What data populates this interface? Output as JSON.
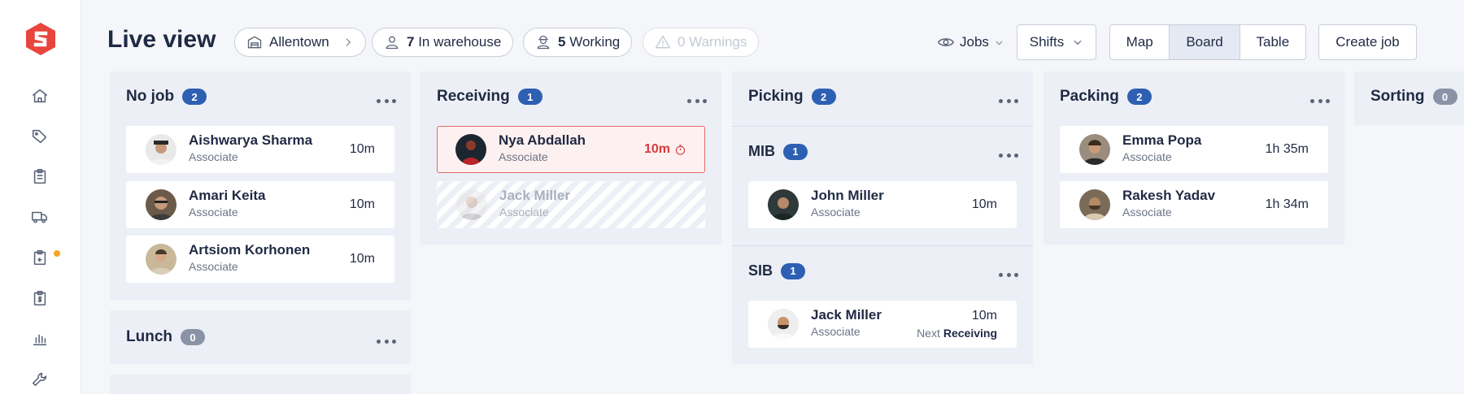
{
  "header": {
    "title": "Live view",
    "location": "Allentown",
    "in_warehouse_count": "7",
    "in_warehouse_label": "In warehouse",
    "working_count": "5",
    "working_label": "Working",
    "warnings_label": "0 Warnings",
    "jobs_label": "Jobs",
    "shifts_label": "Shifts",
    "views": [
      "Map",
      "Board",
      "Table"
    ],
    "active_view": "Board",
    "create_job_label": "Create job"
  },
  "sidebar": {
    "items": [
      "home-icon",
      "tag-icon",
      "clipboard-icon",
      "truck-icon",
      "clipboard-return-icon",
      "clipboard-dollar-icon",
      "bar-chart-icon",
      "wrench-icon"
    ],
    "notification_color": "#f5a524"
  },
  "colors": {
    "accent": "#2d5fb3",
    "alert": "#d9393b",
    "brand": "#e8453c"
  },
  "columns": {
    "no_job": {
      "title": "No job",
      "count": "2",
      "cards": [
        {
          "name": "Aishwarya Sharma",
          "role": "Associate",
          "time": "10m"
        },
        {
          "name": "Amari Keita",
          "role": "Associate",
          "time": "10m"
        },
        {
          "name": "Artsiom Korhonen",
          "role": "Associate",
          "time": "10m"
        }
      ]
    },
    "lunch": {
      "title": "Lunch",
      "count": "0"
    },
    "receiving": {
      "title": "Receiving",
      "count": "1",
      "cards": [
        {
          "name": "Nya Abdallah",
          "role": "Associate",
          "time": "10m",
          "state": "overdue"
        },
        {
          "name": "Jack Miller",
          "role": "Associate",
          "state": "incoming"
        }
      ]
    },
    "picking": {
      "title": "Picking",
      "count": "2",
      "groups": [
        {
          "title": "MIB",
          "count": "1",
          "cards": [
            {
              "name": "John Miller",
              "role": "Associate",
              "time": "10m"
            }
          ]
        },
        {
          "title": "SIB",
          "count": "1",
          "cards": [
            {
              "name": "Jack Miller",
              "role": "Associate",
              "time": "10m",
              "next_label": "Next",
              "next_job": "Receiving"
            }
          ]
        }
      ]
    },
    "packing": {
      "title": "Packing",
      "count": "2",
      "cards": [
        {
          "name": "Emma Popa",
          "role": "Associate",
          "time": "1h 35m"
        },
        {
          "name": "Rakesh Yadav",
          "role": "Associate",
          "time": "1h 34m"
        }
      ]
    },
    "sorting": {
      "title": "Sorting",
      "count": "0"
    }
  }
}
